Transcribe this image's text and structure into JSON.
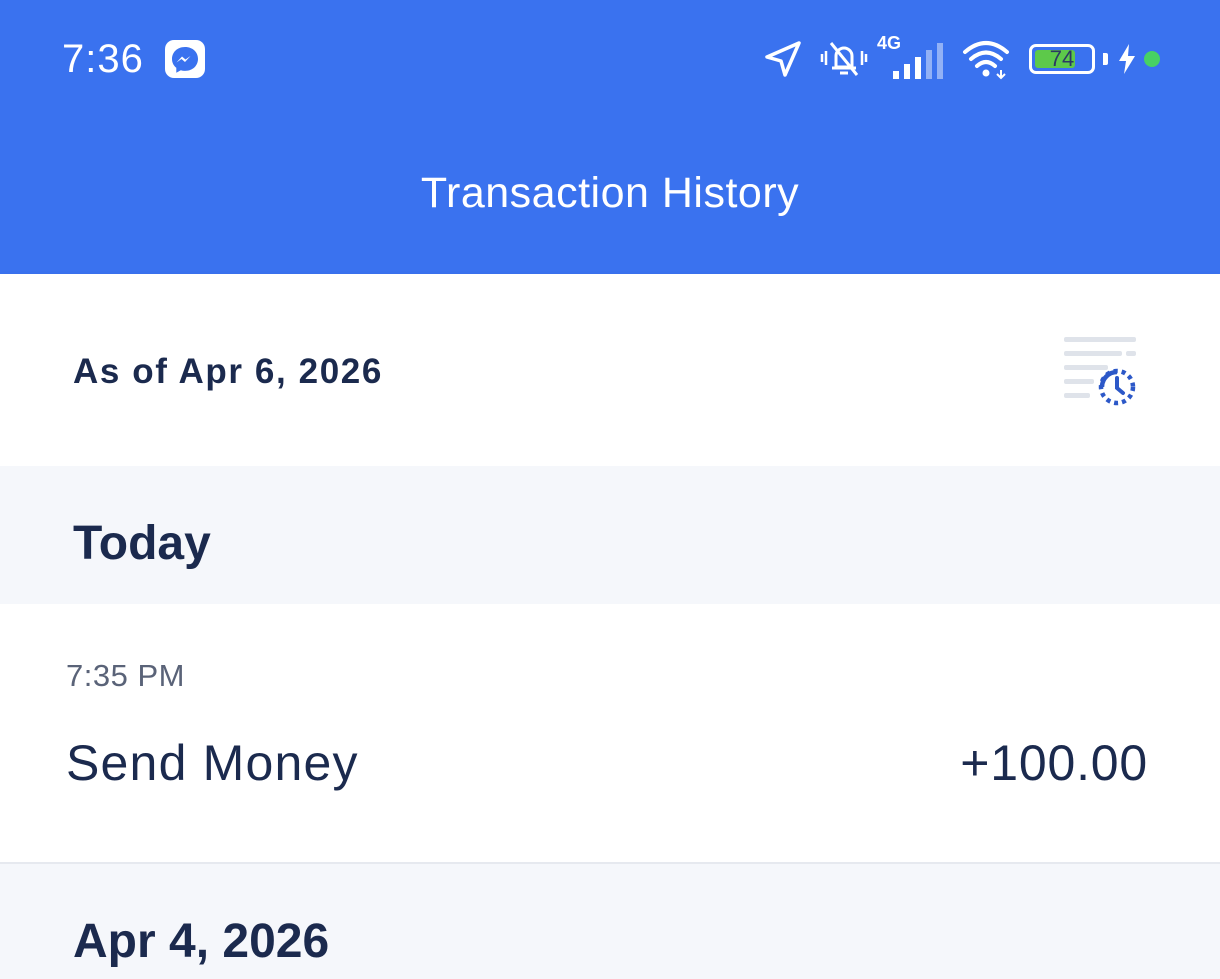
{
  "status_bar": {
    "time": "7:36",
    "notification_icon": "messenger-icon",
    "network_type": "4G",
    "battery_level": "74",
    "battery_fraction": 0.74,
    "icons": [
      "navigation-arrow-icon",
      "vibrate-mute-icon",
      "cell-signal-icon",
      "wifi-icon",
      "battery-icon",
      "charging-bolt-icon",
      "green-dot-icon"
    ],
    "colors": {
      "bar": "#3a72ef",
      "battery_fill": "#5dc94a",
      "dot": "#47d164"
    }
  },
  "header": {
    "title": "Transaction History"
  },
  "summary": {
    "as_of": "As of Apr 6, 2026",
    "action_icon": "history-clock-icon"
  },
  "sections": [
    {
      "title": "Today",
      "transactions": [
        {
          "time": "7:35 PM",
          "type": "Send Money",
          "amount": "+100.00"
        }
      ]
    },
    {
      "title": "Apr 4, 2026",
      "transactions": []
    }
  ],
  "theme": {
    "primary": "#3a72ef",
    "text_dark": "#1b2a4e",
    "text_muted": "#5a6378",
    "background": "#f5f7fb"
  }
}
